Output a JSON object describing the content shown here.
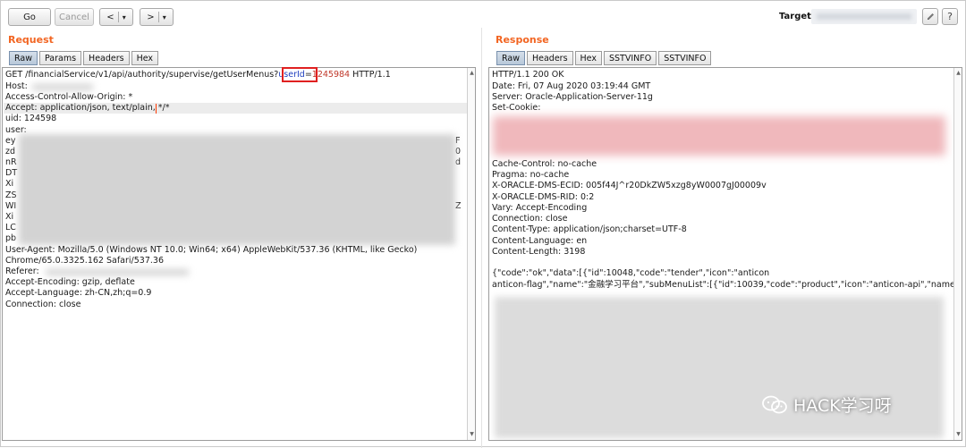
{
  "toolbar": {
    "go_label": "Go",
    "cancel_label": "Cancel",
    "back_glyph": "<",
    "forward_glyph": ">",
    "dropdown_glyph": "▾",
    "target_label": "Target:",
    "edit_icon": "pencil-icon",
    "help_label": "?"
  },
  "request": {
    "title": "Request",
    "tabs": [
      "Raw",
      "Params",
      "Headers",
      "Hex"
    ],
    "active_tab": "Raw",
    "lines": [
      "GET /financialService/v1/api/authority/supervise/getUserMenus?userId=1245984 HTTP/1.1",
      "Host:",
      "Access-Control-Allow-Origin: *",
      "Accept: application/json, text/plain, */*",
      "uid: 124598",
      "user:",
      "User-Agent: Mozilla/5.0 (Windows NT 10.0; Win64; x64) AppleWebKit/537.36 (KHTML, like Gecko)",
      "Chrome/65.0.3325.162 Safari/537.36",
      "Referer:",
      "Accept-Encoding: gzip, deflate",
      "Accept-Language: zh-CN,zh;q=0.9",
      "Connection: close"
    ],
    "request_prefix": "GET /financialService/v1/api/authority/supervise/getUserMenus?",
    "param_name": "userId",
    "param_eq": "=",
    "param_value": "1245984",
    "request_suffix": " HTTP/1.1",
    "blurred_prefixes": [
      "ey",
      "zd",
      "nR",
      "DT",
      "Xi",
      "ZS",
      "WI",
      "Xi",
      "LC",
      "pb"
    ],
    "blurred_suffixes": [
      "F",
      "0",
      "d",
      "",
      "",
      "",
      "Z",
      "",
      "",
      ""
    ]
  },
  "response": {
    "title": "Response",
    "tabs": [
      "Raw",
      "Headers",
      "Hex",
      "SSTVINFO",
      "SSTVINFO"
    ],
    "active_tab": "Raw",
    "lines": [
      "HTTP/1.1 200 OK",
      "Date: Fri, 07 Aug 2020 03:19:44 GMT",
      "Server: Oracle-Application-Server-11g",
      "Set-Cookie:",
      "Cache-Control: no-cache",
      "Pragma: no-cache",
      "X-ORACLE-DMS-ECID: 005f44J^r20DkZW5xzg8yW0007gJ00009v",
      "X-ORACLE-DMS-RID: 0:2",
      "Vary: Accept-Encoding",
      "Connection: close",
      "Content-Type: application/json;charset=UTF-8",
      "Content-Language: en",
      "Content-Length: 3198",
      "",
      "{\"code\":\"ok\",\"data\":[{\"id\":10048,\"code\":\"tender\",\"icon\":\"anticon",
      "anticon-flag\",\"name\":\"金融学习平台\",\"subMenuList\":[{\"id\":10039,\"code\":\"product\",\"icon\":\"anticon-api\",\"name\":\"金融"
    ]
  },
  "watermark": {
    "text": "HACK学习呀",
    "icon": "wechat-icon"
  },
  "colors": {
    "accent": "#f26522",
    "highlight_box": "#e02020",
    "active_tab": "#c4d2e1"
  }
}
